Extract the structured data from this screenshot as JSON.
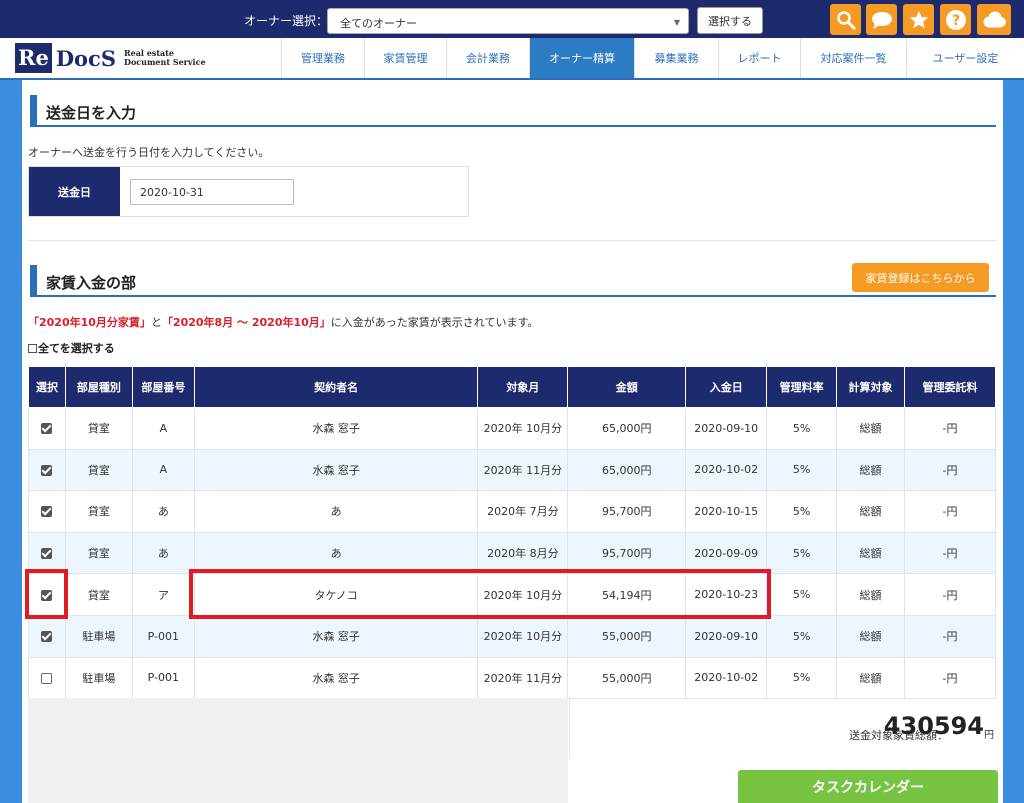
{
  "header": {
    "owner_label": "オーナー選択：",
    "owner_value": "全てのオーナー",
    "select_button": "選択する",
    "tool_icons": [
      "search-icon",
      "chat-icon",
      "star-icon",
      "help-icon",
      "cloud-icon"
    ]
  },
  "logo": {
    "re": "Re",
    "docs": "DocS",
    "line1": "Real estate",
    "line2": "Document Service"
  },
  "nav": [
    "管理業務",
    "家賃管理",
    "会計業務",
    "オーナー精算",
    "募集業務",
    "レポート",
    "対応案件一覧",
    "ユーザー設定"
  ],
  "nav_active": "オーナー精算",
  "send": {
    "title": "送金日を入力",
    "description": "オーナーへ送金を行う日付を入力してください。",
    "label": "送金日",
    "date": "2020-10-31"
  },
  "rent": {
    "title": "家賃入金の部",
    "register_button": "家賃登録はこちらから",
    "notice_part1": "「2020年10月分家賃」",
    "notice_part2": "と",
    "notice_part3": "「2020年8月 ～ 2020年10月」",
    "notice_part4": "に入金があった家賃が表示されています。",
    "select_all": "全てを選択する",
    "columns": [
      "選択",
      "部屋種別",
      "部屋番号",
      "契約者名",
      "対象月",
      "金額",
      "入金日",
      "管理料率",
      "計算対象",
      "管理委託料"
    ],
    "rows": [
      {
        "checked": true,
        "type": "貸室",
        "room": "A",
        "name": "水森 窓子",
        "month": "2020年 10月分",
        "amount": "65,000円",
        "date": "2020-09-10",
        "rate": "5%",
        "target": "総額",
        "fee": "-円"
      },
      {
        "checked": true,
        "type": "貸室",
        "room": "A",
        "name": "水森 窓子",
        "month": "2020年 11月分",
        "amount": "65,000円",
        "date": "2020-10-02",
        "rate": "5%",
        "target": "総額",
        "fee": "-円"
      },
      {
        "checked": true,
        "type": "貸室",
        "room": "あ",
        "name": "あ",
        "month": "2020年 7月分",
        "amount": "95,700円",
        "date": "2020-10-15",
        "rate": "5%",
        "target": "総額",
        "fee": "-円"
      },
      {
        "checked": true,
        "type": "貸室",
        "room": "あ",
        "name": "あ",
        "month": "2020年 8月分",
        "amount": "95,700円",
        "date": "2020-09-09",
        "rate": "5%",
        "target": "総額",
        "fee": "-円"
      },
      {
        "checked": true,
        "type": "貸室",
        "room": "ア",
        "name": "タケノコ",
        "month": "2020年 10月分",
        "amount": "54,194円",
        "date": "2020-10-23",
        "rate": "5%",
        "target": "総額",
        "fee": "-円"
      },
      {
        "checked": true,
        "type": "駐車場",
        "room": "P-001",
        "name": "水森 窓子",
        "month": "2020年 10月分",
        "amount": "55,000円",
        "date": "2020-09-10",
        "rate": "5%",
        "target": "総額",
        "fee": "-円"
      },
      {
        "checked": false,
        "type": "駐車場",
        "room": "P-001",
        "name": "水森 窓子",
        "month": "2020年 11月分",
        "amount": "55,000円",
        "date": "2020-10-02",
        "rate": "5%",
        "target": "総額",
        "fee": "-円"
      }
    ],
    "total_label": "送金対象家賃総額：",
    "total_value": "430594",
    "total_unit": "円"
  },
  "task_calendar": "タスクカレンダー",
  "colors": {
    "navy": "#1d2b6e",
    "accent_blue": "#2c6fb8",
    "orange": "#f59a23",
    "green": "#76c442",
    "highlight_red": "#e01b24"
  }
}
